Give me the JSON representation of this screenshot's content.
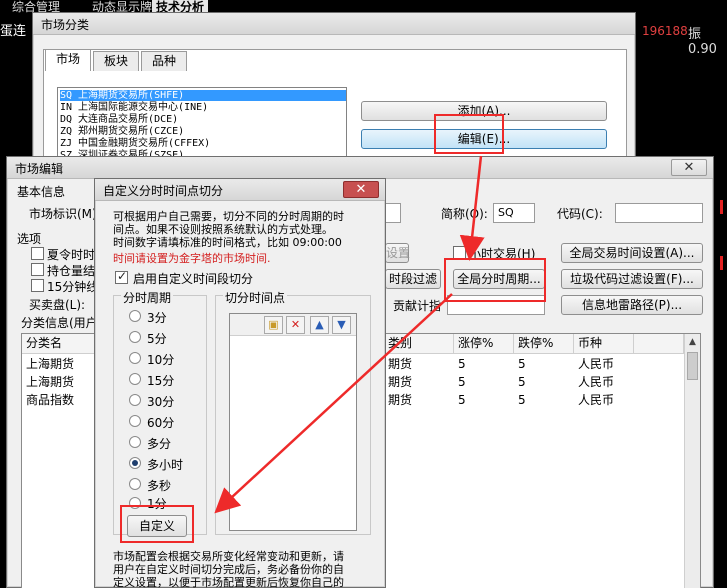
{
  "background": {
    "menus": [
      {
        "label": "综合管理"
      },
      {
        "label": "动态显示牌"
      },
      {
        "label": "技术分析"
      }
    ],
    "ticker_left": "蛋连",
    "ticker_number": "196188",
    "ticker_amp": "振0.90"
  },
  "market_category": {
    "title": "市场分类",
    "tabs": [
      {
        "label": "市场"
      },
      {
        "label": "板块"
      },
      {
        "label": "品种"
      }
    ],
    "list_items": [
      "SQ 上海期货交易所(SHFE)",
      "IN 上海国际能源交易中心(INE)",
      "DQ 大连商品交易所(DCE)",
      "ZQ 郑州期货交易所(CZCE)",
      "ZJ 中国金融期货交易所(CFFEX)",
      "SZ 深圳证券交易所(SZSE)"
    ],
    "add_button": "添加(A)...",
    "edit_button": "编辑(E)..."
  },
  "market_edit": {
    "title": "市场编辑",
    "close_label": "✕",
    "basic_info": "基本信息",
    "market_code_label": "市场标识(M)",
    "abbr_label": "简称(O):",
    "abbr_value": "SQ",
    "code_label": "代码(C):",
    "options_label": "选项",
    "options": [
      {
        "label": "夏令时时"
      },
      {
        "label": "持仓量结"
      },
      {
        "label": "15分钟线"
      }
    ],
    "buy_sell_label": "买卖盘(L):",
    "category_info_label": "分类信息(用户",
    "disabled_btn": "设置",
    "hourly_trade_label": "小时交易(H)",
    "global_trade_time_btn": "全局交易时间设置(A)...",
    "time_filter_btn": "时段过滤",
    "global_period_btn": "全局分时周期...",
    "junk_filter_btn": "垃圾代码过滤设置(F)...",
    "contribution_label": "贡献计指",
    "info_mine_btn": "信息地雷路径(P)...",
    "table": {
      "headers": [
        "分类名",
        "类别",
        "涨停%",
        "跌停%",
        "币种"
      ],
      "rows": [
        [
          "上海期货",
          "期货",
          "5",
          "5",
          "人民币"
        ],
        [
          "上海期货",
          "期货",
          "5",
          "5",
          "人民币"
        ],
        [
          "商品指数",
          "期货",
          "5",
          "5",
          "人民币"
        ]
      ]
    }
  },
  "custom_dialog": {
    "title": "自定义分时时间点切分",
    "close_label": "✕",
    "desc_line1": "可根据用户自己需要，切分不同的分时周期的时",
    "desc_line2": "间点。如果不设则按照系统默认的方式处理。",
    "desc_line3": "时间数字请填标准的时间格式，比如 09:00:00",
    "red_note": "时间请设置为金字塔的市场时间.",
    "enable_label": "启用自定义时间段切分",
    "period_group": "分时周期",
    "periods": [
      "3分",
      "5分",
      "10分",
      "15分",
      "30分",
      "60分",
      "多分",
      "多小时",
      "多秒",
      "1分"
    ],
    "timepoint_group": "切分时间点",
    "custom_btn": "自定义",
    "bottom_line1": "市场配置会根据交易所变化经常变动和更新，请",
    "bottom_line2": "用户在自定义时间切分完成后，务必备份你的自",
    "bottom_line3": "定义设置，以便于市场配置更新后恢复你自己的"
  },
  "colors": {
    "annotation_red": "#ee2a2a",
    "selection_blue": "#3399ff",
    "note_red": "#d42020"
  }
}
